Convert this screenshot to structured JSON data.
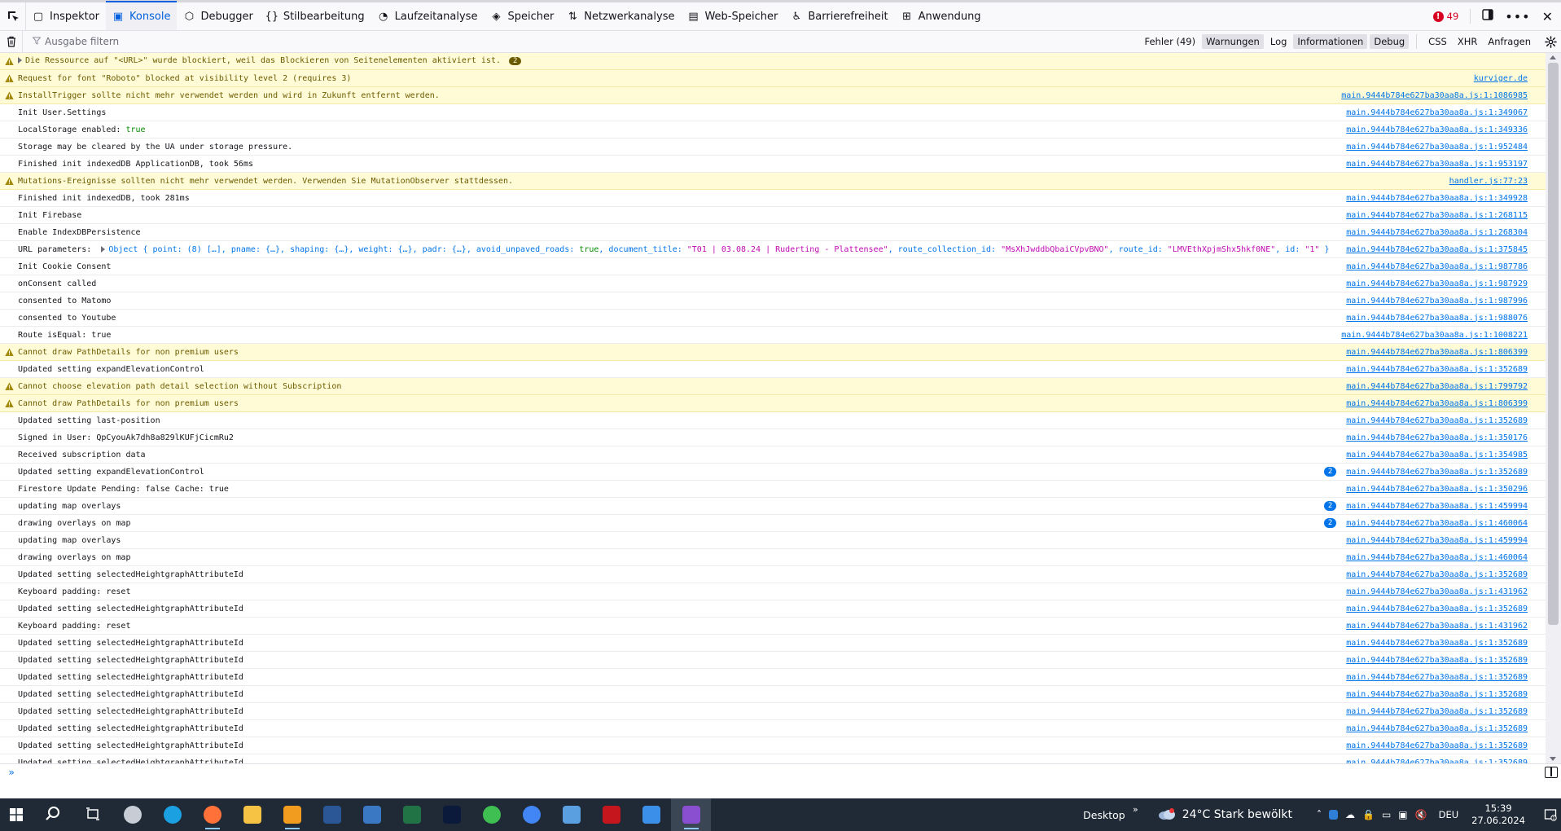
{
  "toolbar": {
    "tabs": [
      {
        "label": "Inspektor",
        "icon": "inspector-icon"
      },
      {
        "label": "Konsole",
        "icon": "console-icon"
      },
      {
        "label": "Debugger",
        "icon": "debugger-icon"
      },
      {
        "label": "Stilbearbeitung",
        "icon": "style-editor-icon"
      },
      {
        "label": "Laufzeitanalyse",
        "icon": "performance-icon"
      },
      {
        "label": "Speicher",
        "icon": "memory-icon"
      },
      {
        "label": "Netzwerkanalyse",
        "icon": "network-icon"
      },
      {
        "label": "Web-Speicher",
        "icon": "storage-icon"
      },
      {
        "label": "Barrierefreiheit",
        "icon": "accessibility-icon"
      },
      {
        "label": "Anwendung",
        "icon": "application-icon"
      }
    ],
    "selected_tab": "Konsole",
    "error_count": "49"
  },
  "filter": {
    "placeholder": "Ausgabe filtern",
    "levels": [
      {
        "label": "Fehler (49)",
        "on": false
      },
      {
        "label": "Warnungen",
        "on": true
      },
      {
        "label": "Log",
        "on": false
      },
      {
        "label": "Informationen",
        "on": true
      },
      {
        "label": "Debug",
        "on": true
      }
    ],
    "types": [
      "CSS",
      "XHR",
      "Anfragen"
    ]
  },
  "messages": [
    {
      "level": "warn",
      "expand": true,
      "text": "Die Ressource auf \"<URL>\" wurde blockiert, weil das Blockieren von Seitenelementen aktiviert ist.",
      "group_count": "2",
      "source": ""
    },
    {
      "level": "warn",
      "text": "Request for font \"Roboto\" blocked at visibility level 2 (requires 3)",
      "source": "kurviger.de"
    },
    {
      "level": "warn",
      "text": "InstallTrigger sollte nicht mehr verwendet werden und wird in Zukunft entfernt werden.",
      "source": "main.9444b784e627ba30aa8a.js:1:1086985"
    },
    {
      "level": "log",
      "text": "Init User.Settings",
      "source": "main.9444b784e627ba30aa8a.js:1:349067"
    },
    {
      "level": "log",
      "text": "LocalStorage enabled: ",
      "bool": "true",
      "source": "main.9444b784e627ba30aa8a.js:1:349336"
    },
    {
      "level": "log",
      "text": "Storage may be cleared by the UA under storage pressure.",
      "source": "main.9444b784e627ba30aa8a.js:1:952484"
    },
    {
      "level": "log",
      "text": "Finished init indexedDB ApplicationDB, took 56ms",
      "source": "main.9444b784e627ba30aa8a.js:1:953197"
    },
    {
      "level": "warn",
      "text": "Mutations-Ereignisse sollten nicht mehr verwendet werden. Verwenden Sie MutationObserver stattdessen.",
      "source": "handler.js:77:23"
    },
    {
      "level": "log",
      "text": "Finished init indexedDB, took 281ms",
      "source": "main.9444b784e627ba30aa8a.js:1:349928"
    },
    {
      "level": "log",
      "text": "Init Firebase",
      "source": "main.9444b784e627ba30aa8a.js:1:268115"
    },
    {
      "level": "log",
      "text": "Enable IndexDBPersistence",
      "source": "main.9444b784e627ba30aa8a.js:1:268304"
    },
    {
      "level": "log",
      "object": true,
      "prefix": "URL parameters: ",
      "obj_a": "Object { point: (8) […], pname: {…}, shaping: {…}, weight: {…}, padr: {…}, avoid_unpaved_roads: ",
      "obj_true": "true",
      "obj_b": ", document_title: ",
      "title_str": "\"T01 | 03.08.24 | Ruderting - Plattensee\"",
      "obj_c": ", route_collection_id: ",
      "coll_str": "\"MsXhJwddbQbaiCVpvBNO\"",
      "obj_d": ", route_id: ",
      "route_str": "\"LMVEthXpjmShx5hkf0NE\"",
      "obj_e": ", id: ",
      "id_str": "\"1\"",
      "obj_f": " }",
      "source": "main.9444b784e627ba30aa8a.js:1:375845"
    },
    {
      "level": "log",
      "text": "Init Cookie Consent",
      "source": "main.9444b784e627ba30aa8a.js:1:987786"
    },
    {
      "level": "log",
      "text": "onConsent called",
      "source": "main.9444b784e627ba30aa8a.js:1:987929"
    },
    {
      "level": "log",
      "text": "consented to Matomo",
      "source": "main.9444b784e627ba30aa8a.js:1:987996"
    },
    {
      "level": "log",
      "text": "consented to Youtube",
      "source": "main.9444b784e627ba30aa8a.js:1:988076"
    },
    {
      "level": "log",
      "text": "Route isEqual: true",
      "source": "main.9444b784e627ba30aa8a.js:1:1008221"
    },
    {
      "level": "warn",
      "text": "Cannot draw PathDetails for non premium users",
      "source": "main.9444b784e627ba30aa8a.js:1:806399"
    },
    {
      "level": "log",
      "text": "Updated setting expandElevationControl",
      "source": "main.9444b784e627ba30aa8a.js:1:352689"
    },
    {
      "level": "warn",
      "text": "Cannot choose elevation path detail selection without Subscription",
      "source": "main.9444b784e627ba30aa8a.js:1:799792"
    },
    {
      "level": "warn",
      "text": "Cannot draw PathDetails for non premium users",
      "source": "main.9444b784e627ba30aa8a.js:1:806399"
    },
    {
      "level": "log",
      "text": "Updated setting last-position",
      "source": "main.9444b784e627ba30aa8a.js:1:352689"
    },
    {
      "level": "log",
      "text": "Signed in User: QpCyouAk7dh8a829lKUFjCicmRu2",
      "source": "main.9444b784e627ba30aa8a.js:1:350176"
    },
    {
      "level": "log",
      "text": "Received subscription data",
      "source": "main.9444b784e627ba30aa8a.js:1:354985"
    },
    {
      "level": "log",
      "text": "Updated setting expandElevationControl",
      "repeat": "2",
      "source": "main.9444b784e627ba30aa8a.js:1:352689"
    },
    {
      "level": "log",
      "text": "Firestore Update Pending: false Cache: true",
      "source": "main.9444b784e627ba30aa8a.js:1:350296"
    },
    {
      "level": "log",
      "text": "updating map overlays",
      "repeat": "2",
      "source": "main.9444b784e627ba30aa8a.js:1:459994"
    },
    {
      "level": "log",
      "text": "drawing overlays on map",
      "repeat": "2",
      "source": "main.9444b784e627ba30aa8a.js:1:460064"
    },
    {
      "level": "log",
      "text": "updating map overlays",
      "source": "main.9444b784e627ba30aa8a.js:1:459994"
    },
    {
      "level": "log",
      "text": "drawing overlays on map",
      "source": "main.9444b784e627ba30aa8a.js:1:460064"
    },
    {
      "level": "log",
      "text": "Updated setting selectedHeightgraphAttributeId",
      "source": "main.9444b784e627ba30aa8a.js:1:352689"
    },
    {
      "level": "log",
      "text": "Keyboard padding: reset",
      "source": "main.9444b784e627ba30aa8a.js:1:431962"
    },
    {
      "level": "log",
      "text": "Updated setting selectedHeightgraphAttributeId",
      "source": "main.9444b784e627ba30aa8a.js:1:352689"
    },
    {
      "level": "log",
      "text": "Keyboard padding: reset",
      "source": "main.9444b784e627ba30aa8a.js:1:431962"
    },
    {
      "level": "log",
      "text": "Updated setting selectedHeightgraphAttributeId",
      "source": "main.9444b784e627ba30aa8a.js:1:352689"
    },
    {
      "level": "log",
      "text": "Updated setting selectedHeightgraphAttributeId",
      "source": "main.9444b784e627ba30aa8a.js:1:352689"
    },
    {
      "level": "log",
      "text": "Updated setting selectedHeightgraphAttributeId",
      "source": "main.9444b784e627ba30aa8a.js:1:352689"
    },
    {
      "level": "log",
      "text": "Updated setting selectedHeightgraphAttributeId",
      "source": "main.9444b784e627ba30aa8a.js:1:352689"
    },
    {
      "level": "log",
      "text": "Updated setting selectedHeightgraphAttributeId",
      "source": "main.9444b784e627ba30aa8a.js:1:352689"
    },
    {
      "level": "log",
      "text": "Updated setting selectedHeightgraphAttributeId",
      "source": "main.9444b784e627ba30aa8a.js:1:352689"
    },
    {
      "level": "log",
      "text": "Updated setting selectedHeightgraphAttributeId",
      "source": "main.9444b784e627ba30aa8a.js:1:352689"
    },
    {
      "level": "log",
      "text": "Updated setting selectedHeightgraphAttributeId",
      "source": "main.9444b784e627ba30aa8a.js:1:352689"
    }
  ],
  "console_input": {
    "prompt": "»",
    "placeholder": ""
  },
  "taskbar": {
    "apps": [
      "search-icon",
      "task-view-icon",
      "circle-app-icon",
      "edge-icon",
      "firefox-icon",
      "file-explorer-icon",
      "outlook-icon",
      "word-icon",
      "store-icon",
      "excel-icon",
      "photoshop-icon",
      "green-app-icon",
      "chrome-icon",
      "remote-app-icon",
      "red-app-icon",
      "blue-bird-icon",
      "vpn-app-icon"
    ],
    "desktop_label": "Desktop",
    "weather": "24°C  Stark bewölkt",
    "language": "DEU",
    "time": "15:39",
    "date": "27.06.2024"
  },
  "colors": {
    "warn_bg": "#fffbd6",
    "link": "#0074e8",
    "accent": "#0060df",
    "error": "#d70022"
  }
}
